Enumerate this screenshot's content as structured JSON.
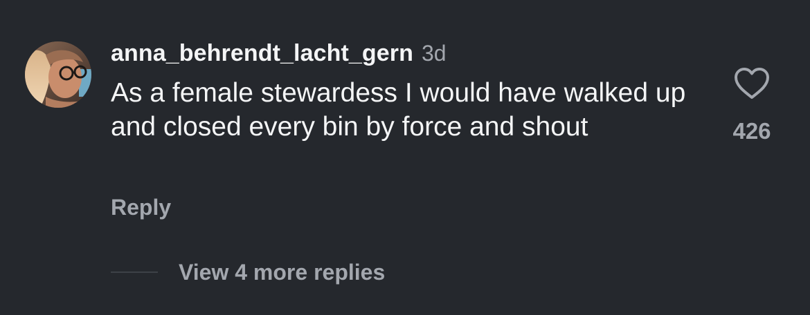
{
  "comment": {
    "username": "anna_behrendt_lacht_gern",
    "timestamp": "3d",
    "text": "As a female stewardess I would have walked up and closed every bin by force and shout",
    "reply_label": "Reply",
    "like_count": "426",
    "view_replies_label": "View 4 more replies"
  },
  "icons": {
    "like": "heart-outline-icon"
  },
  "colors": {
    "background": "#25282d",
    "primary_text": "#f4f5f6",
    "secondary_text": "#a3a7ae"
  }
}
